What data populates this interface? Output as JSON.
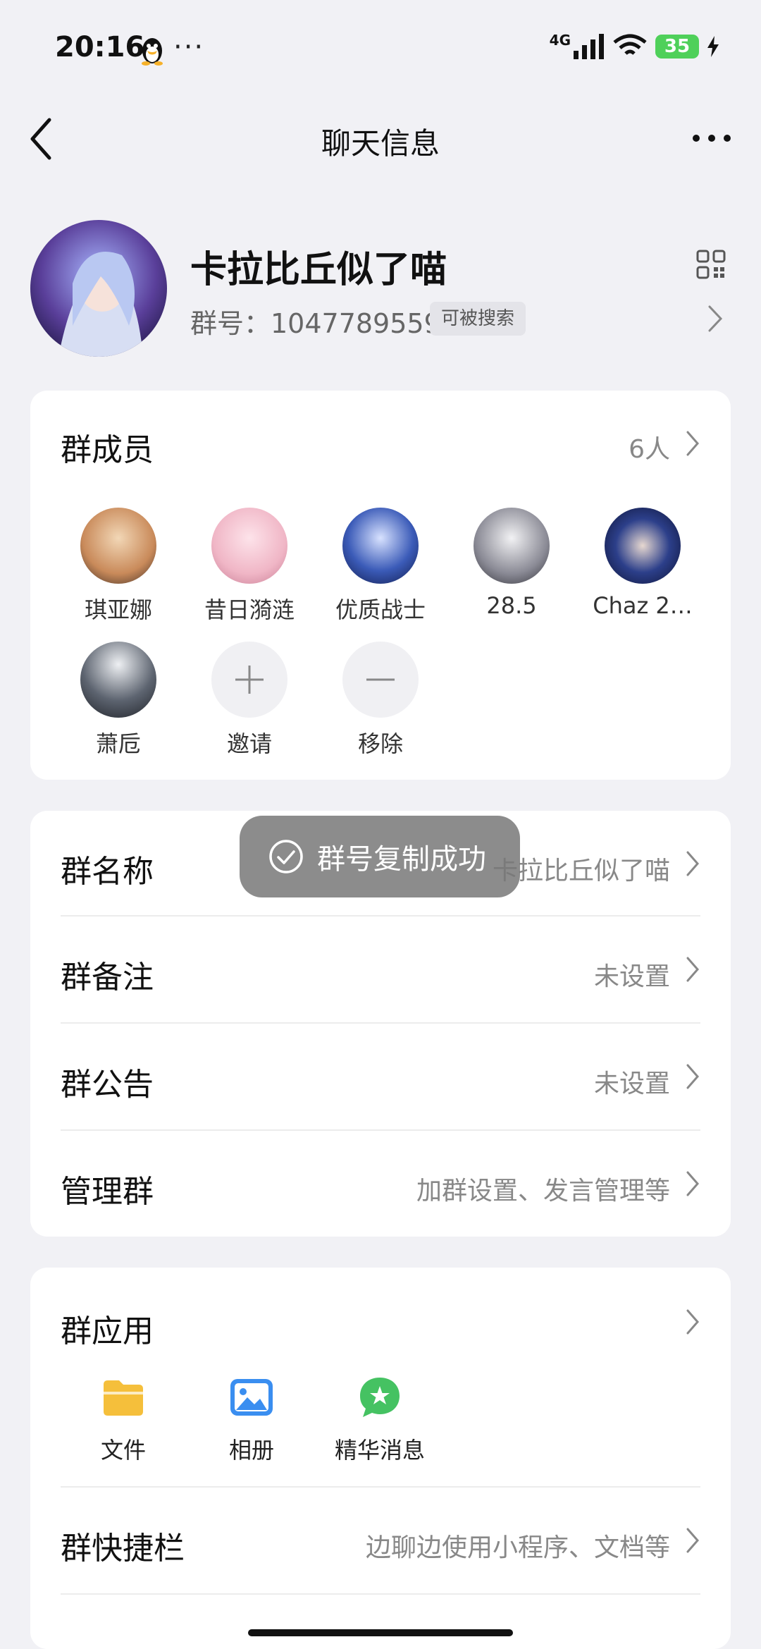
{
  "status_bar": {
    "time": "20:16",
    "dots": "···",
    "network": "4G",
    "battery": "35"
  },
  "nav": {
    "title": "聊天信息"
  },
  "group": {
    "name": "卡拉比丘似了喵",
    "id_text": "群号：1047789559",
    "searchable": "可被搜索"
  },
  "members": {
    "title": "群成员",
    "count": "6人",
    "list": [
      {
        "name": "琪亚娜",
        "color": "#c98a5a"
      },
      {
        "name": "昔日漪涟",
        "color": "#f0b6c6"
      },
      {
        "name": "优质战士",
        "color": "#3b5bb8"
      },
      {
        "name": "28.5",
        "color": "#8a8a95"
      },
      {
        "name": "Chaz 2…",
        "color": "#2c3f8a"
      },
      {
        "name": "萧卮",
        "color": "#5d6470"
      }
    ],
    "invite": "邀请",
    "remove": "移除"
  },
  "settings": {
    "rows": [
      {
        "label": "群名称",
        "value": "卡拉比丘似了喵"
      },
      {
        "label": "群备注",
        "value": "未设置"
      },
      {
        "label": "群公告",
        "value": "未设置"
      },
      {
        "label": "管理群",
        "value": "加群设置、发言管理等"
      }
    ]
  },
  "apps": {
    "title": "群应用",
    "items": [
      {
        "name": "文件",
        "icon": "folder-icon"
      },
      {
        "name": "相册",
        "icon": "album-icon"
      },
      {
        "name": "精华消息",
        "icon": "star-chat-icon"
      }
    ],
    "shortcut_label": "群快捷栏",
    "shortcut_value": "边聊边使用小程序、文档等"
  },
  "toast": {
    "text": "群号复制成功"
  },
  "colors": {
    "accent_green": "#4fd05a",
    "folder": "#f5bf3b",
    "album": "#3a8ef0",
    "star": "#45c262"
  }
}
